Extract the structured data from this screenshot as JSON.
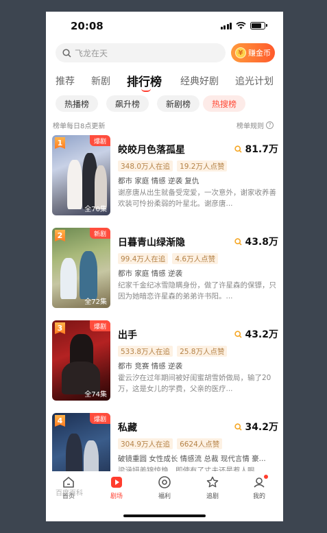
{
  "status_bar": {
    "time": "20:08"
  },
  "search": {
    "placeholder": "飞龙在天",
    "coin_button": "赚金币",
    "coin_glyph": "¥"
  },
  "tabs": [
    "推荐",
    "新剧",
    "排行榜",
    "经典好剧",
    "追光计划"
  ],
  "active_tab": "排行榜",
  "chips": [
    "热播榜",
    "飙升榜",
    "新剧榜",
    "热搜榜"
  ],
  "active_chip": "热搜榜",
  "notice": "榜单每日8点更新",
  "rules_link": "榜单规则",
  "items": [
    {
      "rank": "1",
      "tag": "爆剧",
      "title": "皎皎月色落孤星",
      "heat": "81.7万",
      "following": "348.0万人在追",
      "likes": "19.2万人点赞",
      "genres": "都市 家庭 情感 逆袭 复仇",
      "desc": "谢彦唐从出生就备受宠爱，一次意外，谢家收养善欢装可怜扮柔弱的叶星北。谢彦唐...",
      "episodes": "全70集"
    },
    {
      "rank": "2",
      "tag": "新剧",
      "title": "日暮青山绿渐隐",
      "heat": "43.8万",
      "following": "99.4万人在追",
      "likes": "4.6万人点赞",
      "genres": "都市 家庭 情感 逆袭",
      "desc": "纪家千金纪冰雪隐瞒身份，做了许星森的保镖，只因为她暗恋许星森的弟弟许书阳。...",
      "episodes": "全72集"
    },
    {
      "rank": "3",
      "tag": "爆剧",
      "title": "出手",
      "heat": "43.2万",
      "following": "533.8万人在追",
      "likes": "25.8万人点赞",
      "genres": "都市 竞赛 情感 逆袭",
      "desc": "霍云汐在过年期间被好闺蜜胡雪娇做局，输了20万，这是女儿的学费，父亲的医疗...",
      "episodes": "全74集"
    },
    {
      "rank": "4",
      "tag": "爆剧",
      "title": "私藏",
      "heat": "34.2万",
      "following": "304.9万人在追",
      "likes": "6624人点赞",
      "genres": "破镜重圆 女性成长 情感流 总裁 现代言情 豪...",
      "desc": "梁涵妍姜锦惊艳，即使有了丈夫还是惹人眼...",
      "episodes": ""
    }
  ],
  "bottom_nav": [
    "首页",
    "剧场",
    "福利",
    "追剧",
    "我的"
  ],
  "active_nav": "剧场",
  "watermark": "百度百科",
  "colors": {
    "accent": "#ff3d2e",
    "heat_icon": "#f5a623",
    "stat_bg": "#fdf1e3"
  }
}
